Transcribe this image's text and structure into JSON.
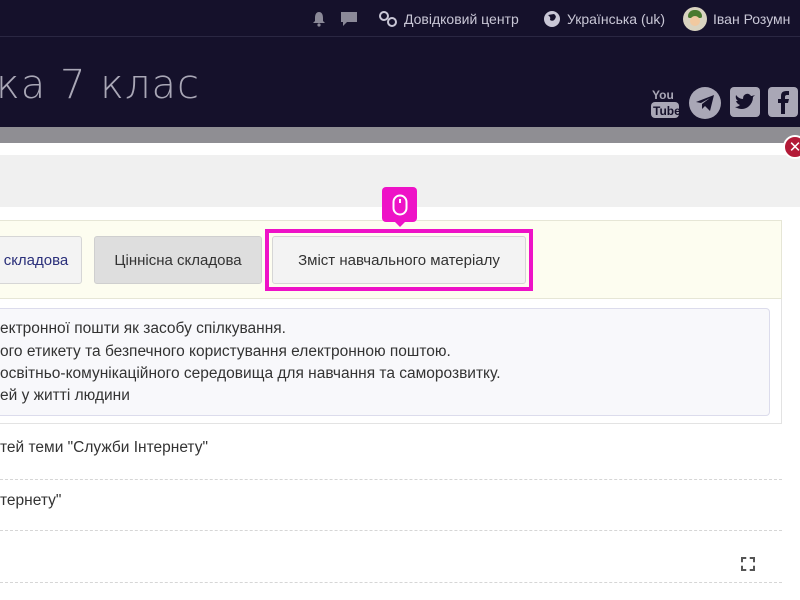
{
  "topbar": {
    "help_center": "Довідковий центр",
    "language": "Українська (uk)",
    "user_name": "Іван Розумн"
  },
  "header": {
    "site_title": "ка 7 клас"
  },
  "social": {
    "youtube_label": "You\nTube"
  },
  "modal": {
    "tabs": [
      {
        "label": "складова"
      },
      {
        "label": "Ціннісна складова"
      },
      {
        "label": "Зміст навчального матеріалу"
      }
    ],
    "content_lines": [
      "ектронної пошти як засобу спілкування.",
      "ого етикету та безпечного користування електронною поштою.",
      "освітньо-комунікаційного середовища для навчання та саморозвитку.",
      "ей у житті людини"
    ],
    "list_items": [
      "тей теми \"Служби Інтернету\"",
      "тернету\""
    ],
    "close_symbol": "✕"
  },
  "colors": {
    "header_bg": "#15112b",
    "highlight": "#ee12c7",
    "close_button": "#b31a37"
  }
}
